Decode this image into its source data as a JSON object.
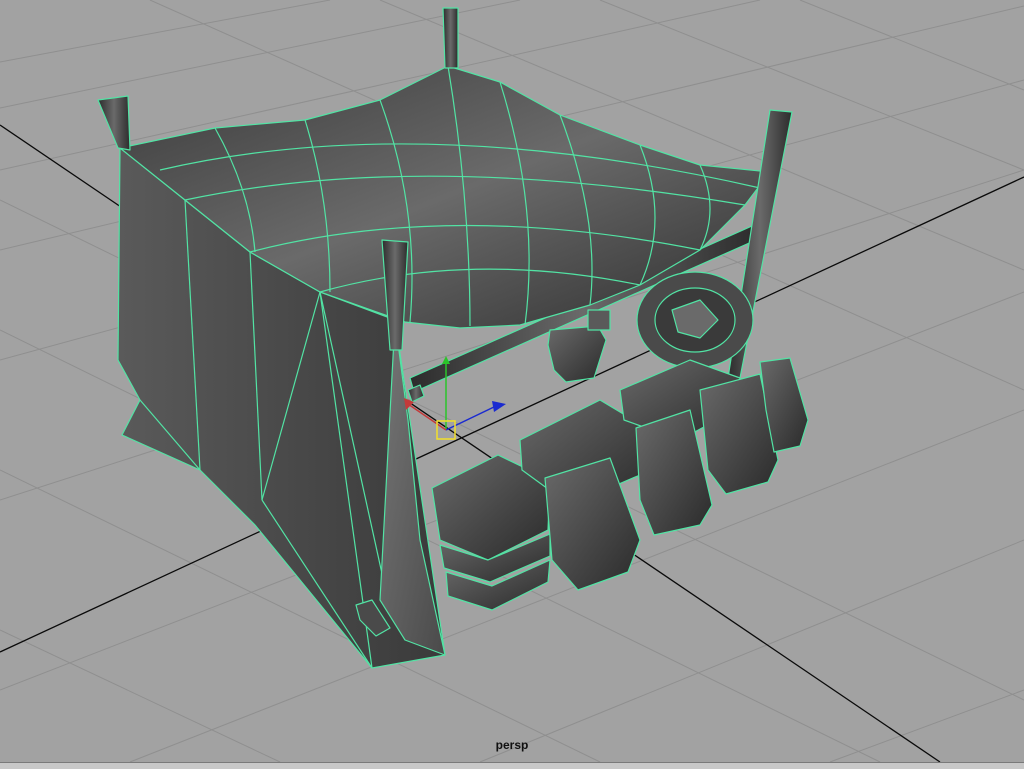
{
  "viewport": {
    "camera_label": "persp",
    "background_color": "#a2a2a2",
    "grid_color": "#8f8f8f",
    "axis_line_color": "#000000",
    "wireframe_color": "#52e3a4"
  },
  "scene": {
    "object": "market-tent-with-crates",
    "selected": true
  },
  "manipulator": {
    "x_axis_color": "#1a2ad0",
    "y_axis_color": "#2ac42a",
    "z_axis_color": "#c43a3a",
    "pivot_color": "#f2e02a"
  }
}
